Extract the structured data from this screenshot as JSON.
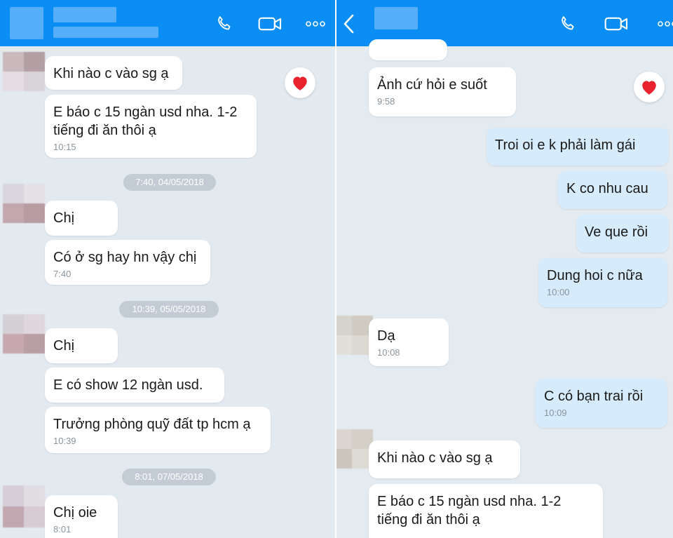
{
  "left": {
    "messages": [
      {
        "text": "Khi nào c vào sg ạ",
        "time": ""
      },
      {
        "text": "E báo c 15 ngàn usd nha. 1-2 tiếng đi ăn thôi ạ",
        "time": "10:15"
      },
      {
        "text": "Chị",
        "time": ""
      },
      {
        "text": "Có ở sg hay hn vậy chị",
        "time": "7:40"
      },
      {
        "text": "Chị",
        "time": ""
      },
      {
        "text": "E có show 12 ngàn usd.",
        "time": ""
      },
      {
        "text": "Trưởng phòng quỹ đất tp hcm ạ",
        "time": "10:39"
      },
      {
        "text": "Chị oie",
        "time": "8:01"
      }
    ],
    "dividers": [
      "7:40, 04/05/2018",
      "10:39, 05/05/2018",
      "8:01, 07/05/2018"
    ]
  },
  "right": {
    "messages": [
      {
        "text": "Ảnh cứ hỏi e suốt",
        "time": "9:58"
      },
      {
        "text": "Troi oi e k phải làm gái",
        "time": ""
      },
      {
        "text": "K co nhu cau",
        "time": ""
      },
      {
        "text": "Ve que rồi",
        "time": ""
      },
      {
        "text": "Dung hoi c nữa",
        "time": "10:00"
      },
      {
        "text": "Dạ",
        "time": "10:08"
      },
      {
        "text": "C có bạn trai rồi",
        "time": "10:09"
      },
      {
        "text": "Khi nào c vào sg ạ",
        "time": ""
      },
      {
        "text": "E báo c 15 ngàn usd nha. 1-2 tiếng đi ăn thôi ạ",
        "time": ""
      }
    ]
  },
  "icons": {
    "call": "phone-icon",
    "video": "video-camera-icon",
    "more": "more-dots-icon",
    "back": "back-chevron-icon",
    "reaction": "heart-icon"
  },
  "colors": {
    "header": "#0a8ef3",
    "incoming": "#ffffff",
    "outgoing": "#d6ebfb",
    "heart": "#e8232e"
  }
}
